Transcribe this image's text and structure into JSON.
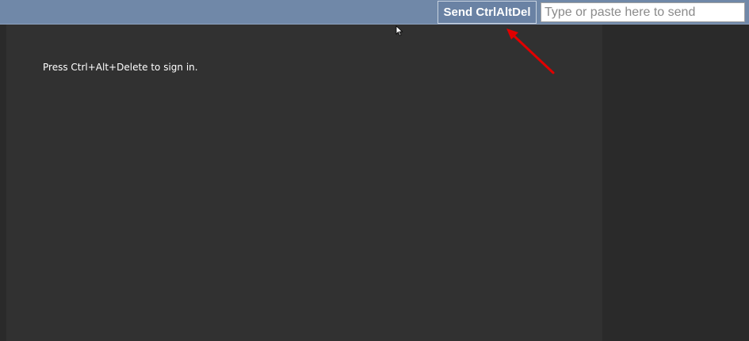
{
  "toolbar": {
    "send_button_label": "Send CtrlAltDel",
    "input_placeholder": "Type or paste here to send",
    "input_value": ""
  },
  "screen": {
    "message": "Press Ctrl+Alt+Delete to sign in."
  },
  "colors": {
    "toolbar_bg": "#7088a8",
    "screen_bg": "#313131",
    "annotation_arrow": "#e00000"
  },
  "icons": {
    "cursor": "mouse-pointer-icon",
    "annotation": "red-arrow-icon"
  }
}
